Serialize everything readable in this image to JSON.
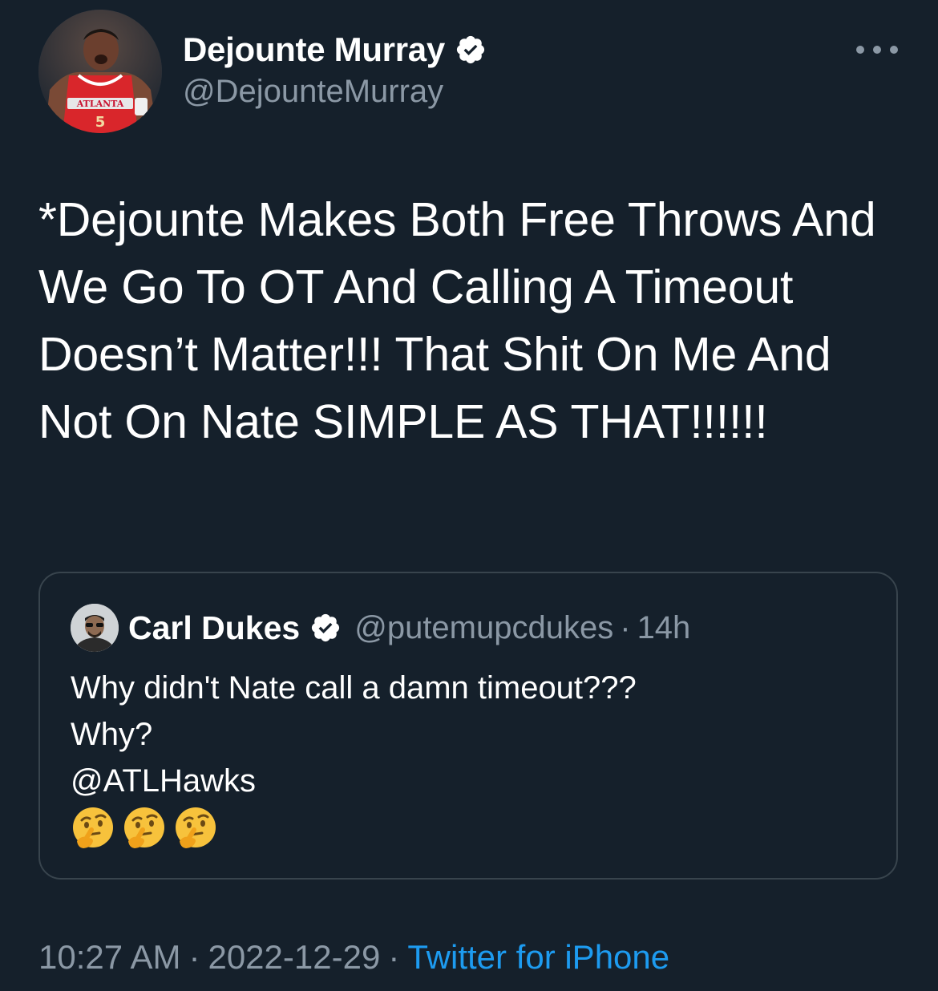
{
  "author": {
    "display_name": "Dejounte Murray",
    "handle": "@DejounteMurray",
    "verified": true,
    "avatar": "player-photo",
    "avatar_jersey_text": "ATLANTA",
    "avatar_jersey_number": "5"
  },
  "menu_icon": "more-horizontal-icon",
  "tweet_text": "*Dejounte Makes Both Free Throws And We Go To OT And Calling A Timeout Doesn’t Matter!!! That Shit On Me And Not On Nate SIMPLE AS THAT!!!!!!",
  "quoted_tweet": {
    "display_name": "Carl Dukes",
    "handle": "@putemupcdukes",
    "separator": "·",
    "time": "14h",
    "verified": true,
    "avatar": "person-photo",
    "lines": [
      "Why didn't Nate call a damn timeout???",
      "Why?",
      "@ATLHawks"
    ],
    "emojis": [
      "thinking-face",
      "thinking-face",
      "thinking-face"
    ]
  },
  "meta": {
    "time": "10:27 AM",
    "separator": "·",
    "date": "2022-12-29",
    "source": "Twitter for iPhone"
  },
  "colors": {
    "background": "#15202b",
    "text": "#ffffff",
    "secondary": "#8b98a5",
    "link": "#1d9bf0",
    "border": "#38444d",
    "verified_badge": "#ffffff"
  }
}
